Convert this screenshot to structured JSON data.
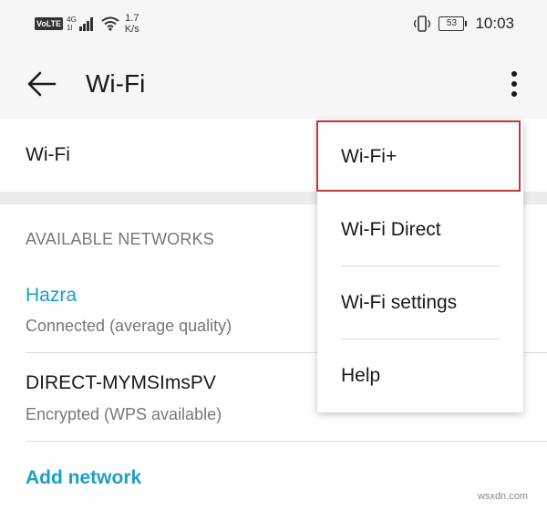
{
  "status_bar": {
    "volte": "VoLTE",
    "network_type": "4G",
    "network_sub": "1l",
    "speed_value": "1.7",
    "speed_unit": "K/s",
    "battery": "53",
    "time": "10:03"
  },
  "toolbar": {
    "title": "Wi-Fi"
  },
  "wifi_toggle": {
    "label": "Wi-Fi"
  },
  "networks": {
    "header": "AVAILABLE NETWORKS",
    "items": [
      {
        "name": "Hazra",
        "status": "Connected (average quality)",
        "name_color": "#1aa0c4"
      },
      {
        "name": "DIRECT-MYMSImsPV",
        "status": "Encrypted (WPS available)",
        "name_color": "#1a1a1a"
      }
    ],
    "add_label": "Add network"
  },
  "overflow_menu": {
    "items": [
      {
        "label": "Wi-Fi+",
        "highlighted": true
      },
      {
        "label": "Wi-Fi Direct",
        "highlighted": false
      },
      {
        "label": "Wi-Fi settings",
        "highlighted": false
      },
      {
        "label": "Help",
        "highlighted": false
      }
    ]
  },
  "colors": {
    "accent": "#1aa0c4",
    "highlight_box": "#c0393b"
  },
  "watermark": "wsxdn.com",
  "icons": [
    "back-arrow-icon",
    "more-vert-icon",
    "wifi-icon",
    "signal-icon",
    "vibrate-icon",
    "battery-icon"
  ]
}
